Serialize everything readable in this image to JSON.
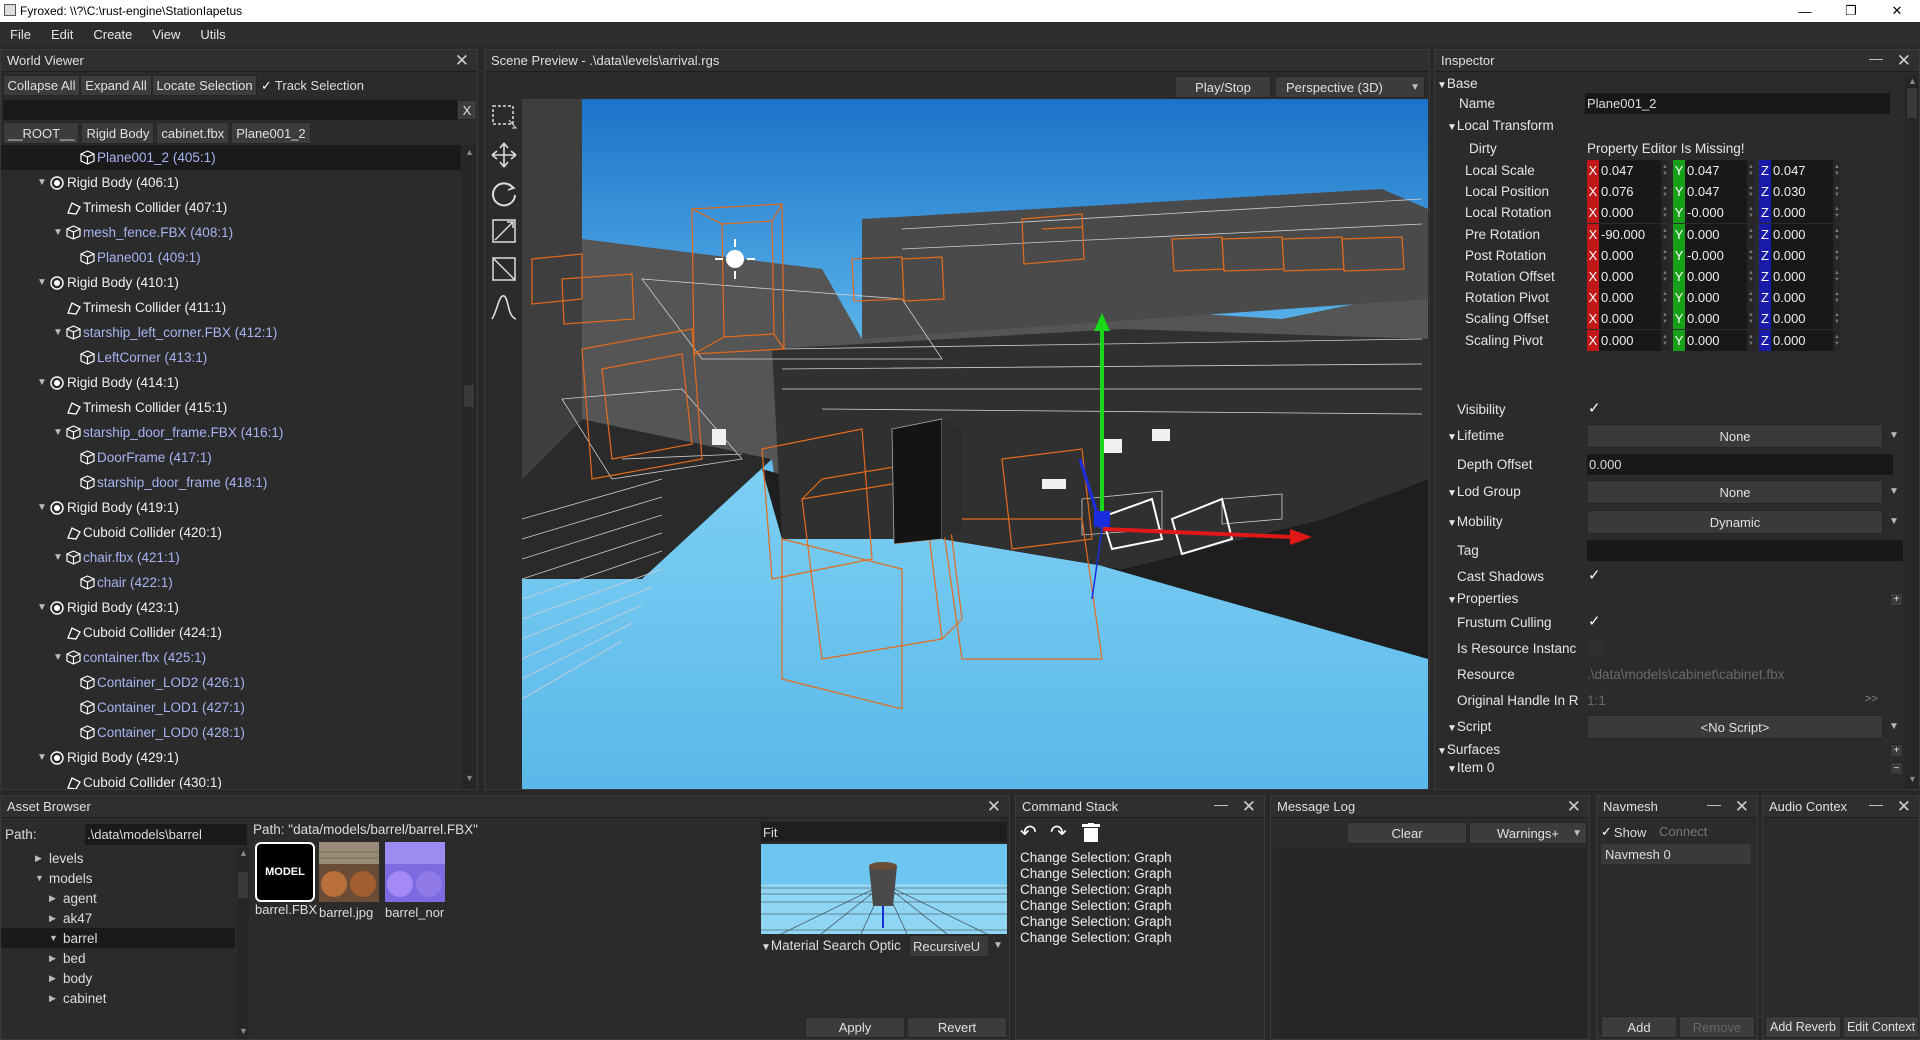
{
  "window": {
    "title": "Fyroxed: \\\\?\\C:\\rust-engine\\StationIapetus",
    "minimize": "—",
    "maximize": "❐",
    "close": "✕"
  },
  "menu": [
    "File",
    "Edit",
    "Create",
    "View",
    "Utils"
  ],
  "world_viewer": {
    "title": "World Viewer",
    "toolbar": {
      "collapse": "Collapse All",
      "expand": "Expand All",
      "locate": "Locate Selection",
      "track": "Track Selection"
    },
    "search_clear": "X",
    "breadcrumb": [
      "__ROOT__",
      "Rigid Body",
      "cabinet.fbx",
      "Plane001_2"
    ],
    "tree": [
      {
        "label": "Plane001_2 (405:1)",
        "indent": 3,
        "kind": "mod",
        "arrow": "",
        "selected": true
      },
      {
        "label": "Rigid Body (406:1)",
        "indent": 1,
        "kind": "body",
        "arrow": "▼"
      },
      {
        "label": "Trimesh Collider (407:1)",
        "indent": 2,
        "kind": "col",
        "arrow": ""
      },
      {
        "label": "mesh_fence.FBX (408:1)",
        "indent": 2,
        "kind": "mod",
        "arrow": "▼"
      },
      {
        "label": "Plane001 (409:1)",
        "indent": 3,
        "kind": "mod",
        "arrow": ""
      },
      {
        "label": "Rigid Body (410:1)",
        "indent": 1,
        "kind": "body",
        "arrow": "▼"
      },
      {
        "label": "Trimesh Collider (411:1)",
        "indent": 2,
        "kind": "col",
        "arrow": ""
      },
      {
        "label": "starship_left_corner.FBX (412:1)",
        "indent": 2,
        "kind": "mod",
        "arrow": "▼"
      },
      {
        "label": "LeftCorner (413:1)",
        "indent": 3,
        "kind": "mod",
        "arrow": ""
      },
      {
        "label": "Rigid Body (414:1)",
        "indent": 1,
        "kind": "body",
        "arrow": "▼"
      },
      {
        "label": "Trimesh Collider (415:1)",
        "indent": 2,
        "kind": "col",
        "arrow": ""
      },
      {
        "label": "starship_door_frame.FBX (416:1)",
        "indent": 2,
        "kind": "mod",
        "arrow": "▼"
      },
      {
        "label": "DoorFrame (417:1)",
        "indent": 3,
        "kind": "mod",
        "arrow": ""
      },
      {
        "label": "starship_door_frame (418:1)",
        "indent": 3,
        "kind": "mod",
        "arrow": ""
      },
      {
        "label": "Rigid Body (419:1)",
        "indent": 1,
        "kind": "body",
        "arrow": "▼"
      },
      {
        "label": "Cuboid Collider (420:1)",
        "indent": 2,
        "kind": "col",
        "arrow": ""
      },
      {
        "label": "chair.fbx (421:1)",
        "indent": 2,
        "kind": "mod",
        "arrow": "▼"
      },
      {
        "label": "chair (422:1)",
        "indent": 3,
        "kind": "mod",
        "arrow": ""
      },
      {
        "label": "Rigid Body (423:1)",
        "indent": 1,
        "kind": "body",
        "arrow": "▼"
      },
      {
        "label": "Cuboid Collider (424:1)",
        "indent": 2,
        "kind": "col",
        "arrow": ""
      },
      {
        "label": "container.fbx (425:1)",
        "indent": 2,
        "kind": "mod",
        "arrow": "▼"
      },
      {
        "label": "Container_LOD2 (426:1)",
        "indent": 3,
        "kind": "mod",
        "arrow": ""
      },
      {
        "label": "Container_LOD1 (427:1)",
        "indent": 3,
        "kind": "mod",
        "arrow": ""
      },
      {
        "label": "Container_LOD0 (428:1)",
        "indent": 3,
        "kind": "mod",
        "arrow": ""
      },
      {
        "label": "Rigid Body (429:1)",
        "indent": 1,
        "kind": "body",
        "arrow": "▼"
      },
      {
        "label": "Cuboid Collider (430:1)",
        "indent": 2,
        "kind": "col",
        "arrow": ""
      }
    ]
  },
  "scene_preview": {
    "title": "Scene Preview - .\\data\\levels\\arrival.rgs",
    "play_stop": "Play/Stop",
    "camera_mode": "Perspective (3D)"
  },
  "inspector": {
    "title": "Inspector",
    "base_group": "Base",
    "name_label": "Name",
    "name_value": "Plane001_2",
    "local_transform": "Local Transform",
    "dirty_label": "Dirty",
    "dirty_value": "Property Editor Is Missing!",
    "vec_rows": [
      {
        "label": "Local Scale",
        "x": "0.047",
        "y": "0.047",
        "z": "0.047"
      },
      {
        "label": "Local Position",
        "x": "0.076",
        "y": "0.047",
        "z": "0.030"
      },
      {
        "label": "Local Rotation",
        "x": "0.000",
        "y": "-0.000",
        "z": "0.000"
      },
      {
        "label": "Pre Rotation",
        "x": "-90.000",
        "y": "0.000",
        "z": "0.000"
      },
      {
        "label": "Post Rotation",
        "x": "0.000",
        "y": "-0.000",
        "z": "0.000"
      },
      {
        "label": "Rotation Offset",
        "x": "0.000",
        "y": "0.000",
        "z": "0.000"
      },
      {
        "label": "Rotation Pivot",
        "x": "0.000",
        "y": "0.000",
        "z": "0.000"
      },
      {
        "label": "Scaling Offset",
        "x": "0.000",
        "y": "0.000",
        "z": "0.000"
      },
      {
        "label": "Scaling Pivot",
        "x": "0.000",
        "y": "0.000",
        "z": "0.000"
      }
    ],
    "axis_x": "X",
    "axis_y": "Y",
    "axis_z": "Z",
    "visibility": "Visibility",
    "lifetime": "Lifetime",
    "lifetime_value": "None",
    "depth_offset": "Depth Offset",
    "depth_offset_value": "0.000",
    "lod_group": "Lod Group",
    "lod_group_value": "None",
    "mobility": "Mobility",
    "mobility_value": "Dynamic",
    "tag": "Tag",
    "cast_shadows": "Cast Shadows",
    "properties": "Properties",
    "frustum_culling": "Frustum Culling",
    "is_resource_instance": "Is Resource Instanc",
    "resource": "Resource",
    "resource_value": ".\\data\\models\\cabinet\\cabinet.fbx",
    "original_handle": "Original Handle In R",
    "original_handle_value": "1:1",
    "original_handle_btn": ">>",
    "script": "Script",
    "script_value": "<No Script>",
    "surfaces": "Surfaces",
    "item0": "Item 0",
    "check": "✓",
    "plus": "+",
    "minus": "−"
  },
  "asset_browser": {
    "title": "Asset Browser",
    "path_label": "Path:",
    "path_value": ".\\data\\models\\barrel",
    "file_path": "Path: \"data/models/barrel/barrel.FBX\"",
    "folders": [
      {
        "label": "levels",
        "indent": 1,
        "arrow": "▶"
      },
      {
        "label": "models",
        "indent": 1,
        "arrow": "▼"
      },
      {
        "label": "agent",
        "indent": 2,
        "arrow": "▶"
      },
      {
        "label": "ak47",
        "indent": 2,
        "arrow": "▶"
      },
      {
        "label": "barrel",
        "indent": 2,
        "arrow": "▼",
        "selected": true
      },
      {
        "label": "bed",
        "indent": 2,
        "arrow": "▶"
      },
      {
        "label": "body",
        "indent": 2,
        "arrow": "▶"
      },
      {
        "label": "cabinet",
        "indent": 2,
        "arrow": "▶"
      }
    ],
    "files": [
      {
        "label": "barrel.FBX",
        "badge": "MODEL"
      },
      {
        "label": "barrel.jpg"
      },
      {
        "label": "barrel_nor"
      }
    ],
    "fit": "Fit",
    "material_search": "Material Search Optic",
    "material_search_value": "RecursiveU",
    "apply": "Apply",
    "revert": "Revert"
  },
  "command_stack": {
    "title": "Command Stack",
    "items": [
      "Change Selection: Graph",
      "Change Selection: Graph",
      "Change Selection: Graph",
      "Change Selection: Graph",
      "Change Selection: Graph",
      "Change Selection: Graph"
    ]
  },
  "message_log": {
    "title": "Message Log",
    "clear": "Clear",
    "filter": "Warnings+"
  },
  "navmesh": {
    "title": "Navmesh",
    "show": "Show",
    "connect": "Connect",
    "items": [
      "Navmesh 0"
    ],
    "add": "Add",
    "remove": "Remove"
  },
  "audio": {
    "title": "Audio Contex",
    "add_reverb": "Add Reverb",
    "edit_context": "Edit Context"
  },
  "colors": {
    "accent_x": "#c01818",
    "accent_y": "#18a018",
    "accent_z": "#1a1aa8",
    "model_text": "#a6b3f0",
    "sky": "#60baeb"
  }
}
